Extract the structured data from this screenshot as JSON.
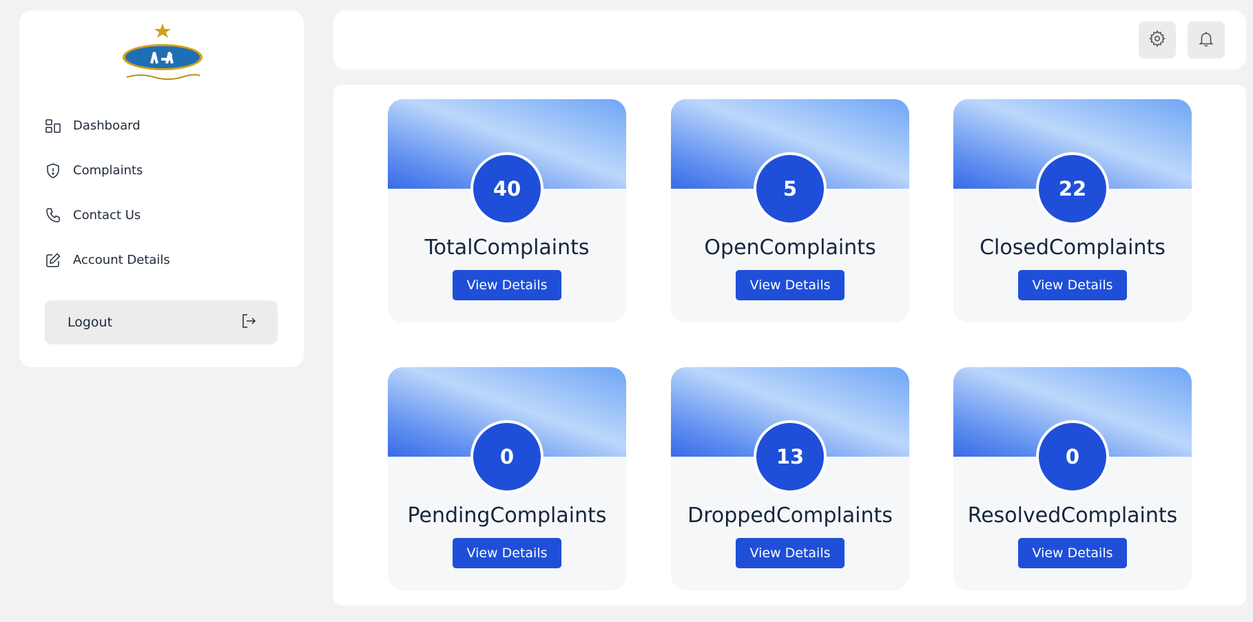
{
  "sidebar": {
    "logo_text": "CAA",
    "items": [
      {
        "label": "Dashboard"
      },
      {
        "label": "Complaints"
      },
      {
        "label": "Contact Us"
      },
      {
        "label": "Account Details"
      }
    ],
    "logout_label": "Logout"
  },
  "header": {
    "settings_icon": "gear-icon",
    "notifications_icon": "bell-icon"
  },
  "cards": [
    {
      "count": "40",
      "title": "TotalComplaints",
      "button": "View Details"
    },
    {
      "count": "5",
      "title": "OpenComplaints",
      "button": "View Details"
    },
    {
      "count": "22",
      "title": "ClosedComplaints",
      "button": "View Details"
    },
    {
      "count": "0",
      "title": "PendingComplaints",
      "button": "View Details"
    },
    {
      "count": "13",
      "title": "DroppedComplaints",
      "button": "View Details"
    },
    {
      "count": "0",
      "title": "ResolvedComplaints",
      "button": "View Details"
    }
  ],
  "colors": {
    "accent": "#1f4fd8",
    "background": "#f2f2f2",
    "logo_blue": "#1e6fb5",
    "logo_gold": "#d4a017"
  }
}
